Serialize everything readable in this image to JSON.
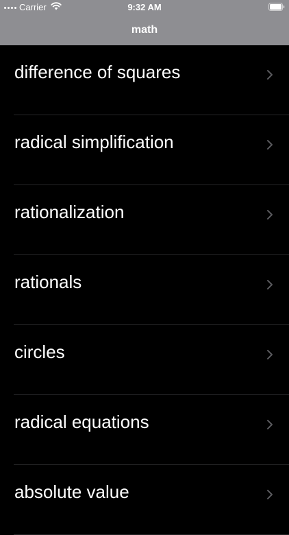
{
  "status_bar": {
    "carrier": "Carrier",
    "time": "9:32 AM",
    "icons": [
      "signal-dots-icon",
      "wifi-icon",
      "battery-icon"
    ]
  },
  "nav": {
    "title": "math",
    "background": "#8e8e92"
  },
  "list": {
    "items": [
      {
        "label": "difference of squares",
        "icon": "chevron-right-icon"
      },
      {
        "label": "radical simplification",
        "icon": "chevron-right-icon"
      },
      {
        "label": "rationalization",
        "icon": "chevron-right-icon"
      },
      {
        "label": "rationals",
        "icon": "chevron-right-icon"
      },
      {
        "label": "circles",
        "icon": "chevron-right-icon"
      },
      {
        "label": "radical equations",
        "icon": "chevron-right-icon"
      },
      {
        "label": "absolute value",
        "icon": "chevron-right-icon"
      }
    ],
    "accent_chevron_color": "#5a5a5e"
  }
}
